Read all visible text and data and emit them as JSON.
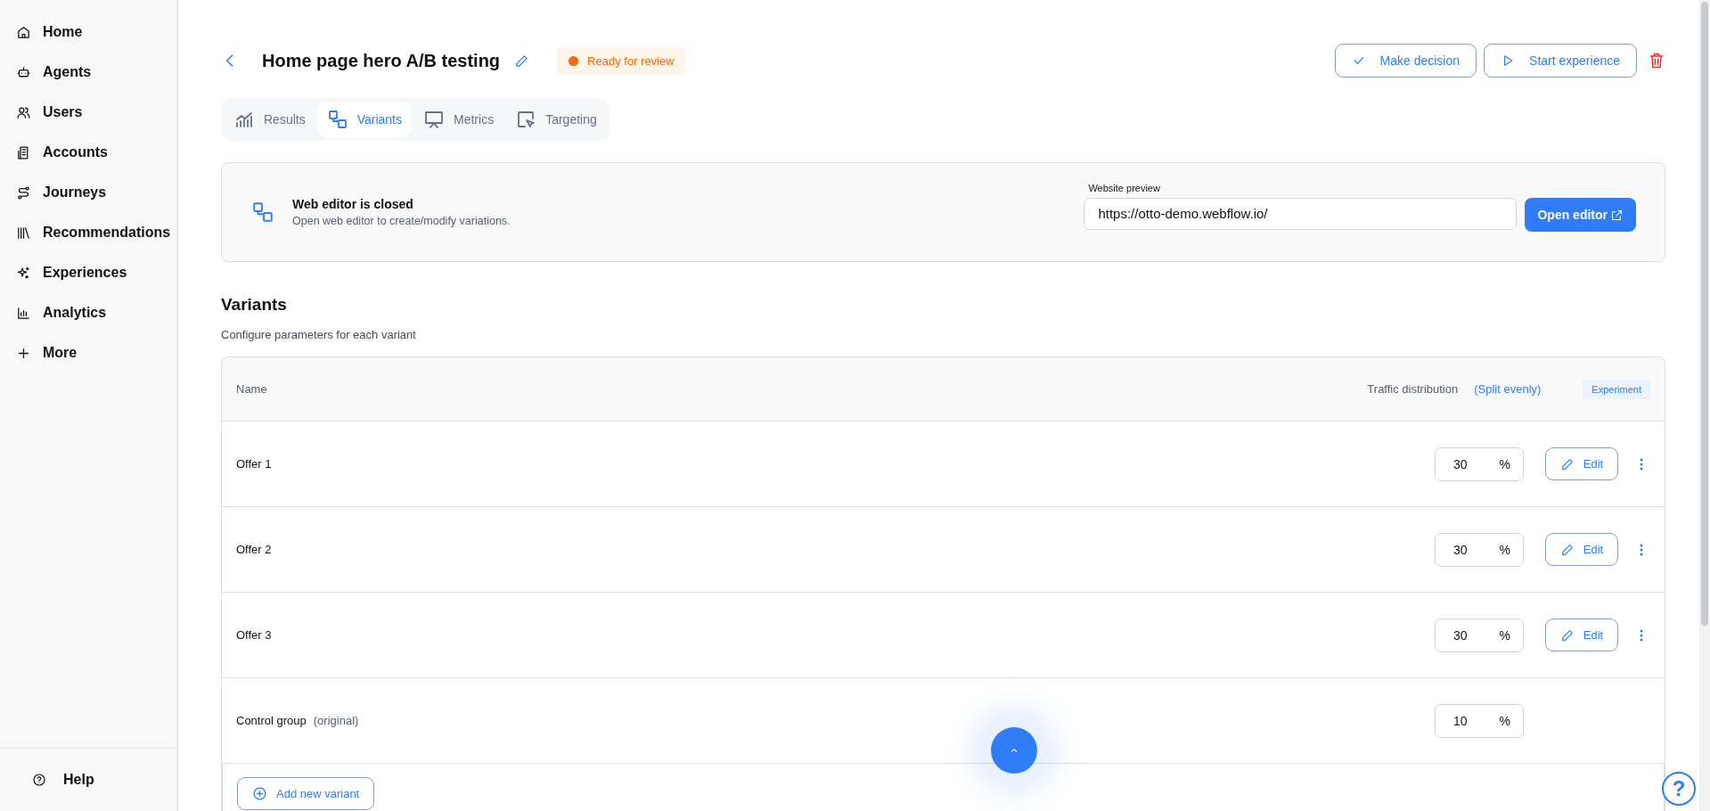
{
  "sidebar": {
    "items": [
      {
        "label": "Home"
      },
      {
        "label": "Agents"
      },
      {
        "label": "Users"
      },
      {
        "label": "Accounts"
      },
      {
        "label": "Journeys"
      },
      {
        "label": "Recommendations"
      },
      {
        "label": "Experiences"
      },
      {
        "label": "Analytics"
      },
      {
        "label": "More"
      }
    ],
    "help": "Help"
  },
  "header": {
    "title": "Home page hero A/B testing",
    "status": "Ready for review",
    "actions": [
      "Make decision",
      "Start experience"
    ]
  },
  "tabs": [
    {
      "label": "Results",
      "selected": false
    },
    {
      "label": "Variants",
      "selected": true
    },
    {
      "label": "Metrics",
      "selected": false
    },
    {
      "label": "Targeting",
      "selected": false
    }
  ],
  "editor_panel": {
    "title": "Web editor is closed",
    "subtitle": "Open web editor to create/modify variations.",
    "preview_label": "Website preview",
    "preview_url": "https://otto-demo.webflow.io/",
    "button": "Open editor"
  },
  "variants": {
    "title": "Variants",
    "subtitle": "Configure parameters for each variant",
    "table": {
      "columns": [
        "Name",
        "Traffic distribution"
      ],
      "split_link": "(Split evenly)",
      "badge": "Experiment",
      "rows": [
        {
          "kind": "variant",
          "name": "Offer 1",
          "value": "30",
          "unit": "%",
          "edit": "Edit"
        },
        {
          "kind": "variant",
          "name": "Offer 2",
          "value": "30",
          "unit": "%",
          "edit": "Edit"
        },
        {
          "kind": "variant",
          "name": "Offer 3",
          "value": "30",
          "unit": "%",
          "edit": "Edit"
        },
        {
          "kind": "control",
          "name": "Control group",
          "note": "(original)",
          "value": "10",
          "unit": "%"
        }
      ]
    },
    "add_button": "Add new variant"
  },
  "help_button": "?"
}
